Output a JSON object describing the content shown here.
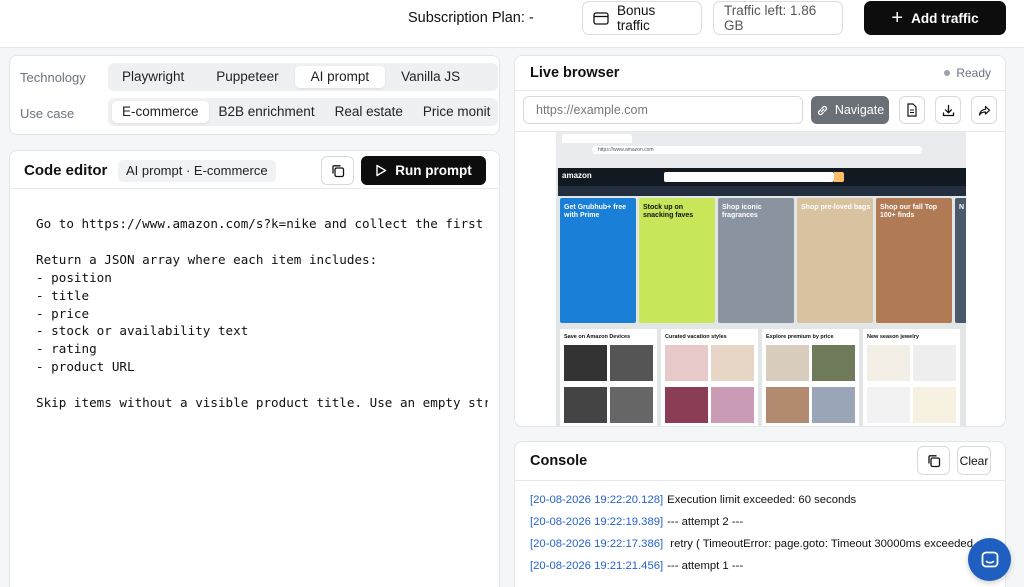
{
  "header": {
    "plan_label": "Subscription Plan: -",
    "bonus_label": "Bonus traffic",
    "traffic_left": "Traffic left: 1.86 GB",
    "add_traffic": "Add traffic"
  },
  "config": {
    "technology_label": "Technology",
    "technology_options": [
      "Playwright",
      "Puppeteer",
      "AI prompt",
      "Vanilla JS"
    ],
    "technology_selected": "AI prompt",
    "usecase_label": "Use case",
    "usecase_options": [
      "E-commerce",
      "B2B enrichment",
      "Real estate",
      "Price monit"
    ],
    "usecase_selected": "E-commerce"
  },
  "editor": {
    "title": "Code editor",
    "chip": "AI prompt · E-commerce",
    "run_label": "Run prompt",
    "code": "Go to https://www.amazon.com/s?k=nike and collect the first\n\nReturn a JSON array where each item includes:\n- position\n- title\n- price\n- stock or availability text\n- rating\n- product URL\n\nSkip items without a visible product title. Use an empty str"
  },
  "browser": {
    "title": "Live browser",
    "status": "Ready",
    "url_placeholder": "https://example.com",
    "navigate_label": "Navigate",
    "preview": {
      "address": "https://www.amazon.com",
      "logo": "amazon",
      "tiles": [
        {
          "text": "Get Grubhub+ free with Prime",
          "color": "#1a7fd6",
          "dark": false
        },
        {
          "text": "Stock up on snacking faves",
          "color": "#c8e65a",
          "dark": true
        },
        {
          "text": "Shop iconic fragrances",
          "color": "#8a93a0",
          "dark": false
        },
        {
          "text": "Shop pre-loved bags",
          "color": "#d8c2a0",
          "dark": false
        },
        {
          "text": "Shop our fall Top 100+ finds",
          "color": "#b07a55",
          "dark": false
        },
        {
          "text": "N K",
          "color": "#4a5a6a",
          "dark": false
        }
      ],
      "categories": [
        {
          "title": "Save on Amazon Devices",
          "colors": [
            "#333",
            "#555",
            "#444",
            "#666"
          ]
        },
        {
          "title": "Curated vacation styles",
          "colors": [
            "#e8c9c9",
            "#e7d5c6",
            "#8a3d55",
            "#c99bb5"
          ]
        },
        {
          "title": "Explore premium by price",
          "colors": [
            "#d9cdbd",
            "#6e7a5a",
            "#b28a70",
            "#9aa6b8"
          ]
        },
        {
          "title": "New season jewelry",
          "colors": [
            "#f3efe7",
            "#eeeeee",
            "#f2f2f2",
            "#f7f1e2"
          ]
        }
      ]
    }
  },
  "console": {
    "title": "Console",
    "clear_label": "Clear",
    "logs": [
      {
        "ts": "[20-08-2026 19:22:20.128]",
        "msg": "Execution limit exceeded: 60 seconds"
      },
      {
        "ts": "[20-08-2026 19:22:19.389]",
        "msg": "--- attempt 2 ---"
      },
      {
        "ts": "[20-08-2026 19:22:17.386]",
        "msg": " retry ( TimeoutError: page.goto: Timeout 30000ms exceeded"
      },
      {
        "ts": "[20-08-2026 19:21:21.456]",
        "msg": "--- attempt 1 ---"
      }
    ]
  },
  "colors": {
    "accent": "#0d0d0d",
    "timestamp": "#2563c9",
    "chat": "#1f5fbf"
  }
}
